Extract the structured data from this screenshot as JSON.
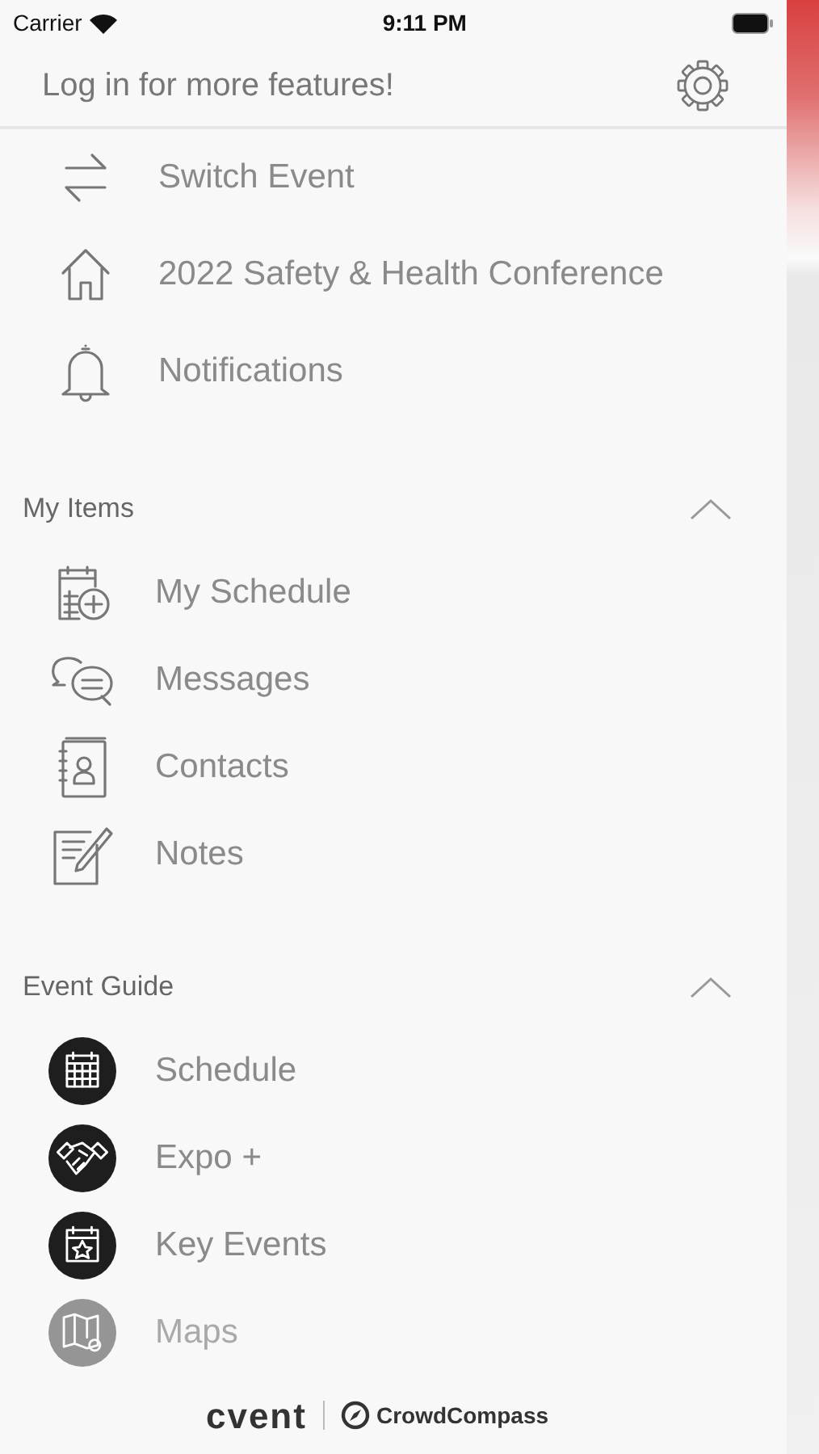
{
  "status_bar": {
    "carrier": "Carrier",
    "time": "9:11 PM"
  },
  "header": {
    "title": "Log in for more features!"
  },
  "top_items": [
    {
      "label": "Switch Event",
      "kind": "switch"
    },
    {
      "label": "2022 Safety & Health Conference",
      "kind": "home"
    },
    {
      "label": "Notifications",
      "kind": "bell"
    }
  ],
  "sections": [
    {
      "title": "My Items",
      "expanded": true,
      "items": [
        {
          "label": "My Schedule",
          "kind": "calendar-plus",
          "faded": false
        },
        {
          "label": "Messages",
          "kind": "chat",
          "faded": false
        },
        {
          "label": "Contacts",
          "kind": "contacts",
          "faded": false
        },
        {
          "label": "Notes",
          "kind": "note",
          "faded": false
        }
      ]
    },
    {
      "title": "Event Guide",
      "expanded": true,
      "items": [
        {
          "label": "Schedule",
          "kind": "calendar-grid",
          "faded": false
        },
        {
          "label": "Expo +",
          "kind": "handshake",
          "faded": false
        },
        {
          "label": "Key Events",
          "kind": "calendar-star",
          "faded": false
        },
        {
          "label": "Maps",
          "kind": "map",
          "faded": true
        }
      ]
    }
  ],
  "footer": {
    "brand": "cvent",
    "partner": "CrowdCompass"
  }
}
